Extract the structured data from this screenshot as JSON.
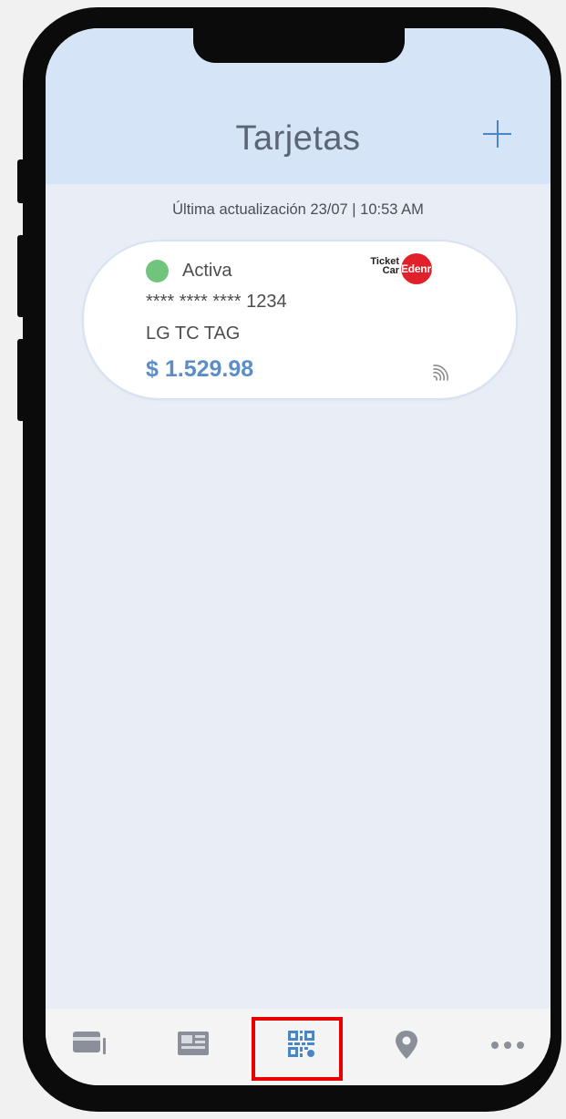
{
  "header": {
    "title": "Tarjetas"
  },
  "last_update": "Última actualización 23/07 | 10:53 AM",
  "card": {
    "status": "Activa",
    "number": "**** **** **** 1234",
    "name": "LG TC TAG",
    "balance": "$ 1.529.98",
    "logo_text": {
      "ticket": "Ticket",
      "car": "Car",
      "edenred": "Edenred"
    }
  },
  "icons": {
    "add": "plus-icon",
    "contactless": "contactless-icon",
    "tabs": [
      "cards-icon",
      "news-icon",
      "qr-code-icon",
      "location-icon",
      "more-icon"
    ]
  },
  "colors": {
    "header_bg": "#d6e4f8",
    "status_active": "#70c47c",
    "balance": "#5b8ec8",
    "accent": "#4a86c6",
    "highlight_box": "#e60000"
  }
}
